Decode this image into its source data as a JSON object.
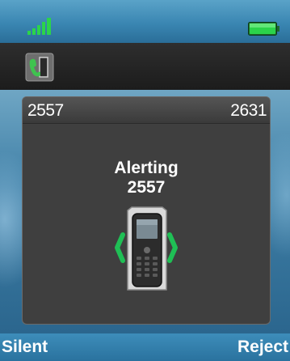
{
  "status_bar": {
    "signal_icon": "signal-strength-icon",
    "battery_icon": "battery-icon",
    "colors": {
      "signal": "#2bd44a",
      "battery": "#2bd44a"
    }
  },
  "toolbar": {
    "icon": "handset-door-icon"
  },
  "call": {
    "local_number": "2557",
    "remote_number": "2631",
    "status": "Alerting",
    "number": "2557",
    "icon": "ringing-phone-icon"
  },
  "softkeys": {
    "left": "Silent",
    "right": "Reject"
  }
}
